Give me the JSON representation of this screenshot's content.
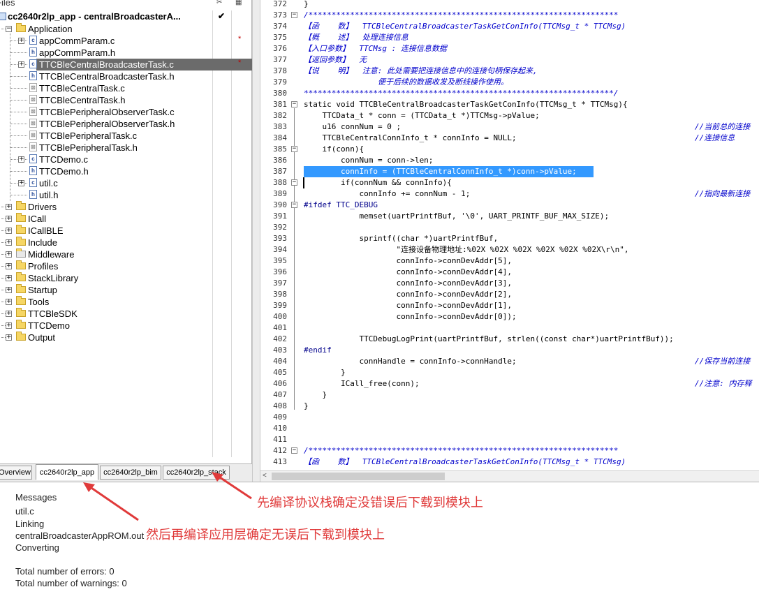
{
  "workspace": {
    "title": "Files",
    "project_name": "cc2640r2lp_app - centralBroadcasterA...",
    "project_check": "✔",
    "tree": [
      {
        "label": "Application",
        "type": "folder",
        "depth": 1,
        "expander": "−"
      },
      {
        "label": "appCommParam.c",
        "type": "c",
        "depth": 2,
        "expander": "+",
        "modified": "*"
      },
      {
        "label": "appCommParam.h",
        "type": "h",
        "depth": 2
      },
      {
        "label": "TTCBleCentralBroadcasterTask.c",
        "type": "c",
        "depth": 2,
        "expander": "+",
        "selected": true,
        "modified": "*"
      },
      {
        "label": "TTCBleCentralBroadcasterTask.h",
        "type": "h",
        "depth": 2
      },
      {
        "label": "TTCBleCentralTask.c",
        "type": "x",
        "depth": 2
      },
      {
        "label": "TTCBleCentralTask.h",
        "type": "x",
        "depth": 2
      },
      {
        "label": "TTCBlePeripheralObserverTask.c",
        "type": "x",
        "depth": 2
      },
      {
        "label": "TTCBlePeripheralObserverTask.h",
        "type": "x",
        "depth": 2
      },
      {
        "label": "TTCBlePeripheralTask.c",
        "type": "x",
        "depth": 2
      },
      {
        "label": "TTCBlePeripheralTask.h",
        "type": "x",
        "depth": 2
      },
      {
        "label": "TTCDemo.c",
        "type": "c",
        "depth": 2,
        "expander": "+"
      },
      {
        "label": "TTCDemo.h",
        "type": "h",
        "depth": 2
      },
      {
        "label": "util.c",
        "type": "c",
        "depth": 2,
        "expander": "+"
      },
      {
        "label": "util.h",
        "type": "h",
        "depth": 2
      },
      {
        "label": "Drivers",
        "type": "folder",
        "depth": 1,
        "expander": "+"
      },
      {
        "label": "ICall",
        "type": "folder",
        "depth": 1,
        "expander": "+"
      },
      {
        "label": "ICallBLE",
        "type": "folder",
        "depth": 1,
        "expander": "+"
      },
      {
        "label": "Include",
        "type": "folder",
        "depth": 1,
        "expander": "+"
      },
      {
        "label": "Middleware",
        "type": "xfolder",
        "depth": 1,
        "expander": "+"
      },
      {
        "label": "Profiles",
        "type": "folder",
        "depth": 1,
        "expander": "+"
      },
      {
        "label": "StackLibrary",
        "type": "folder",
        "depth": 1,
        "expander": "+"
      },
      {
        "label": "Startup",
        "type": "folder",
        "depth": 1,
        "expander": "+"
      },
      {
        "label": "Tools",
        "type": "folder",
        "depth": 1,
        "expander": "+"
      },
      {
        "label": "TTCBleSDK",
        "type": "folder",
        "depth": 1,
        "expander": "+"
      },
      {
        "label": "TTCDemo",
        "type": "folder",
        "depth": 1,
        "expander": "+"
      },
      {
        "label": "Output",
        "type": "folder",
        "depth": 1,
        "expander": "+"
      }
    ],
    "tabs": [
      "Overview",
      "cc2640r2lp_app",
      "cc2640r2lp_bim",
      "cc2640r2lp_stack"
    ]
  },
  "editor": {
    "colors": {
      "keyword": "#00008b",
      "comment": "#0000cc",
      "string": "#000000",
      "number": "#008000",
      "highlight": "#3399ff",
      "stars": "#0000ff"
    },
    "lines": [
      {
        "n": "372",
        "code": "}"
      },
      {
        "n": "373",
        "code": "/*******************************************************************",
        "kind": "comment",
        "fold": "−"
      },
      {
        "n": "374",
        "code": "【函    数】  TTCBleCentralBroadcasterTaskGetConInfo(TTCMsg_t * TTCMsg)",
        "kind": "comment"
      },
      {
        "n": "375",
        "code": "【概    述】  处理连接信息",
        "kind": "comment"
      },
      {
        "n": "376",
        "code": "【入口参数】  TTCMsg : 连接信息数据",
        "kind": "comment"
      },
      {
        "n": "377",
        "code": "【返回参数】  无",
        "kind": "comment"
      },
      {
        "n": "378",
        "code": "【说    明】  注意: 此处需要把连接信息中的连接句柄保存起来,",
        "kind": "comment"
      },
      {
        "n": "379",
        "code": "                便于后续的数据收发及断线操作使用。",
        "kind": "comment"
      },
      {
        "n": "380",
        "code": "*******************************************************************/",
        "kind": "comment"
      },
      {
        "n": "381",
        "code": "static void TTCBleCentralBroadcasterTaskGetConInfo(TTCMsg_t * TTCMsg){",
        "fold": "−"
      },
      {
        "n": "382",
        "code": "    TTCData_t * conn = (TTCData_t *)TTCMsg->pValue;"
      },
      {
        "n": "383",
        "code": "    u16 connNum = 0 ;",
        "tail": "//当前总的连接"
      },
      {
        "n": "384",
        "code": "    TTCBleCentralConnInfo_t * connInfo = NULL;",
        "tail": "//连接信息"
      },
      {
        "n": "385",
        "code": "    if(conn){",
        "fold": "−"
      },
      {
        "n": "386",
        "code": "        connNum = conn->len;"
      },
      {
        "n": "387",
        "code": "        connInfo = (TTCBleCentralConnInfo_t *)conn->pValue;",
        "highlight": true
      },
      {
        "n": "388",
        "code": "        if(connNum && connInfo){",
        "fold": "−",
        "caret": true
      },
      {
        "n": "389",
        "code": "            connInfo += connNum - 1;",
        "tail": "//指向最新连接"
      },
      {
        "n": "390",
        "code": "#ifdef TTC_DEBUG",
        "fold": "−",
        "kind": "pre"
      },
      {
        "n": "391",
        "code": "            memset(uartPrintfBuf, '\\0', UART_PRINTF_BUF_MAX_SIZE);"
      },
      {
        "n": "392",
        "code": ""
      },
      {
        "n": "393",
        "code": "            sprintf((char *)uartPrintfBuf,"
      },
      {
        "n": "394",
        "code": "                    \"连接设备物理地址:%02X %02X %02X %02X %02X %02X\\r\\n\","
      },
      {
        "n": "395",
        "code": "                    connInfo->connDevAddr[5],"
      },
      {
        "n": "396",
        "code": "                    connInfo->connDevAddr[4],"
      },
      {
        "n": "397",
        "code": "                    connInfo->connDevAddr[3],"
      },
      {
        "n": "398",
        "code": "                    connInfo->connDevAddr[2],"
      },
      {
        "n": "399",
        "code": "                    connInfo->connDevAddr[1],"
      },
      {
        "n": "400",
        "code": "                    connInfo->connDevAddr[0]);"
      },
      {
        "n": "401",
        "code": ""
      },
      {
        "n": "402",
        "code": "            TTCDebugLogPrint(uartPrintfBuf, strlen((const char*)uartPrintfBuf));"
      },
      {
        "n": "403",
        "code": "#endif",
        "kind": "pre"
      },
      {
        "n": "404",
        "code": "            connHandle = connInfo->connHandle;",
        "tail": "//保存当前连接"
      },
      {
        "n": "405",
        "code": "        }"
      },
      {
        "n": "406",
        "code": "        ICall_free(conn);",
        "tail": "//注意: 内存释"
      },
      {
        "n": "407",
        "code": "    }"
      },
      {
        "n": "408",
        "code": "}"
      },
      {
        "n": "409",
        "code": ""
      },
      {
        "n": "410",
        "code": ""
      },
      {
        "n": "411",
        "code": ""
      },
      {
        "n": "412",
        "code": "/*******************************************************************",
        "kind": "comment",
        "fold": "−"
      },
      {
        "n": "413",
        "code": "【函    数】  TTCBleCentralBroadcasterTaskGetConInfo(TTCMsg_t * TTCMsg)",
        "kind": "comment"
      }
    ]
  },
  "messages": {
    "lines": [
      "Messages",
      "util.c",
      "Linking",
      "centralBroadcasterAppROM.out",
      "Converting",
      "",
      "Total number of errors: 0",
      "Total number of warnings: 0"
    ]
  },
  "annotations": {
    "note1": "先编译协议栈确定没错误后下载到模块上",
    "note2": "然后再编译应用层确定无误后下载到模块上",
    "color": "#e03a3a"
  }
}
